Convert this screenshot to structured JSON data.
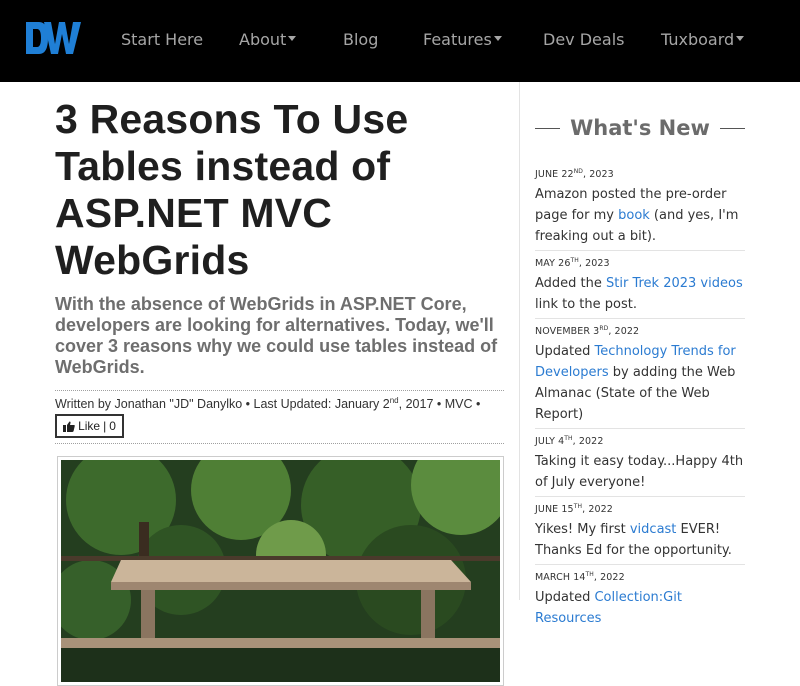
{
  "nav": {
    "logo_text": "DW",
    "items": [
      {
        "label": "Start Here",
        "dropdown": false
      },
      {
        "label": "About",
        "dropdown": true
      },
      {
        "label": "Blog",
        "dropdown": false
      },
      {
        "label": "Features",
        "dropdown": true
      },
      {
        "label": "Dev Deals",
        "dropdown": false
      },
      {
        "label": "Tuxboard",
        "dropdown": true
      }
    ]
  },
  "article": {
    "title": "3 Reasons To Use Tables instead of ASP.NET MVC WebGrids",
    "subtitle": "With the absence of WebGrids in ASP.NET Core, developers are looking for alternatives. Today, we'll cover 3 reasons why we could use tables instead of WebGrids.",
    "byline": {
      "prefix": "Written by Jonathan \"JD\" Danylko • Last Updated: January 2",
      "day_suffix": "nd",
      "rest": ", 2017 • MVC •"
    },
    "like": {
      "label": "Like",
      "separator": "|",
      "count": "0"
    }
  },
  "sidebar": {
    "heading": "What's New",
    "items": [
      {
        "date_prefix": "June 22",
        "date_suffix": "nd",
        "date_year": ", 2023",
        "before": "Amazon posted the pre-order page for my ",
        "link": "book",
        "after": " (and yes, I'm freaking out a bit)."
      },
      {
        "date_prefix": "May 26",
        "date_suffix": "th",
        "date_year": ", 2023",
        "before": "Added the ",
        "link": "Stir Trek 2023 videos",
        "after": " link to the post."
      },
      {
        "date_prefix": "November 3",
        "date_suffix": "rd",
        "date_year": ", 2022",
        "before": "Updated ",
        "link": "Technology Trends for Developers",
        "after": " by adding the Web Almanac (State of the Web Report)"
      },
      {
        "date_prefix": "July 4",
        "date_suffix": "th",
        "date_year": ", 2022",
        "before": "Taking it easy today...Happy 4th of July everyone!",
        "link": "",
        "after": ""
      },
      {
        "date_prefix": "June 15",
        "date_suffix": "th",
        "date_year": ", 2022",
        "before": "Yikes! My first ",
        "link": "vidcast",
        "after": " EVER! Thanks Ed for the opportunity."
      },
      {
        "date_prefix": "March 14",
        "date_suffix": "th",
        "date_year": ", 2022",
        "before": "Updated ",
        "link": "Collection:Git Resources",
        "after": ""
      }
    ]
  },
  "colors": {
    "navbar_bg": "#000000",
    "logo_blue": "#1f7fd6",
    "link": "#2b7bd1"
  }
}
